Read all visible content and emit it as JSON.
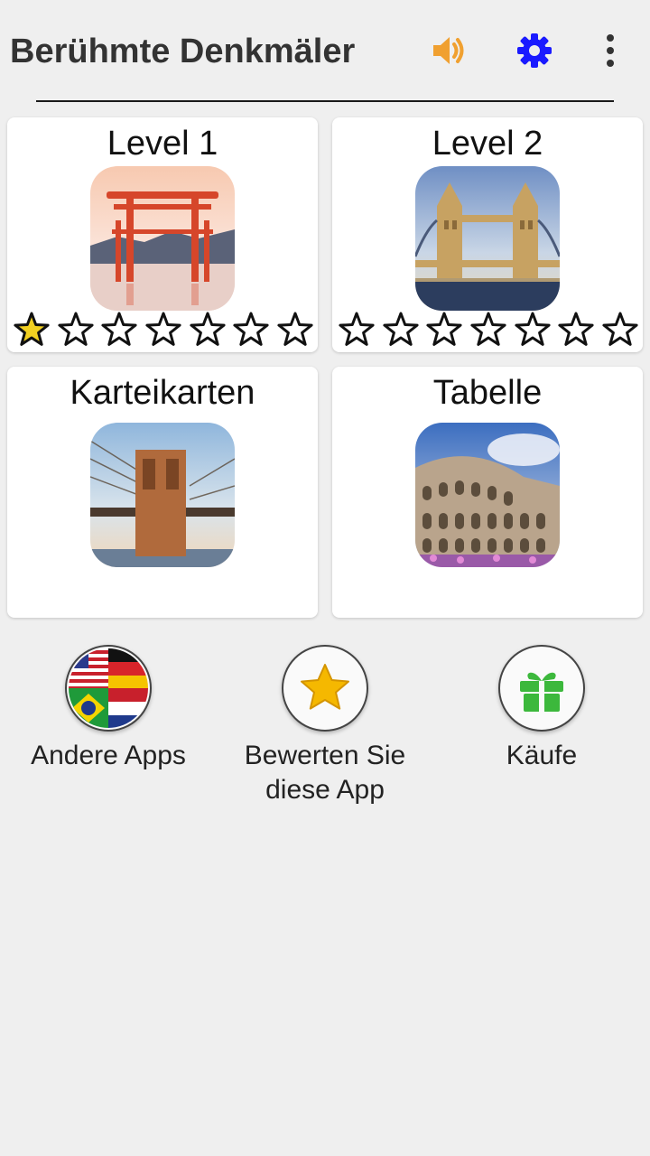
{
  "app": {
    "title": "Berühmte Denkmäler"
  },
  "toolbar": {
    "sound_icon": "speaker-icon",
    "settings_icon": "gear-icon",
    "menu_icon": "overflow-menu-icon"
  },
  "colors": {
    "sound": "#f0a030",
    "settings": "#1a1aff",
    "star_filled": "#f2d021",
    "gift": "#3cb83c"
  },
  "cards": [
    {
      "title": "Level 1",
      "image": "torii-gate-image",
      "stars_total": 7,
      "stars_filled": 1
    },
    {
      "title": "Level 2",
      "image": "tower-bridge-image",
      "stars_total": 7,
      "stars_filled": 0
    },
    {
      "title": "Karteikarten",
      "image": "brooklyn-bridge-image"
    },
    {
      "title": "Tabelle",
      "image": "colosseum-image"
    }
  ],
  "bottom": [
    {
      "label": "Andere Apps",
      "icon": "flags-icon"
    },
    {
      "label": "Bewerten Sie diese App",
      "icon": "star-icon"
    },
    {
      "label": "Käufe",
      "icon": "gift-icon"
    }
  ]
}
